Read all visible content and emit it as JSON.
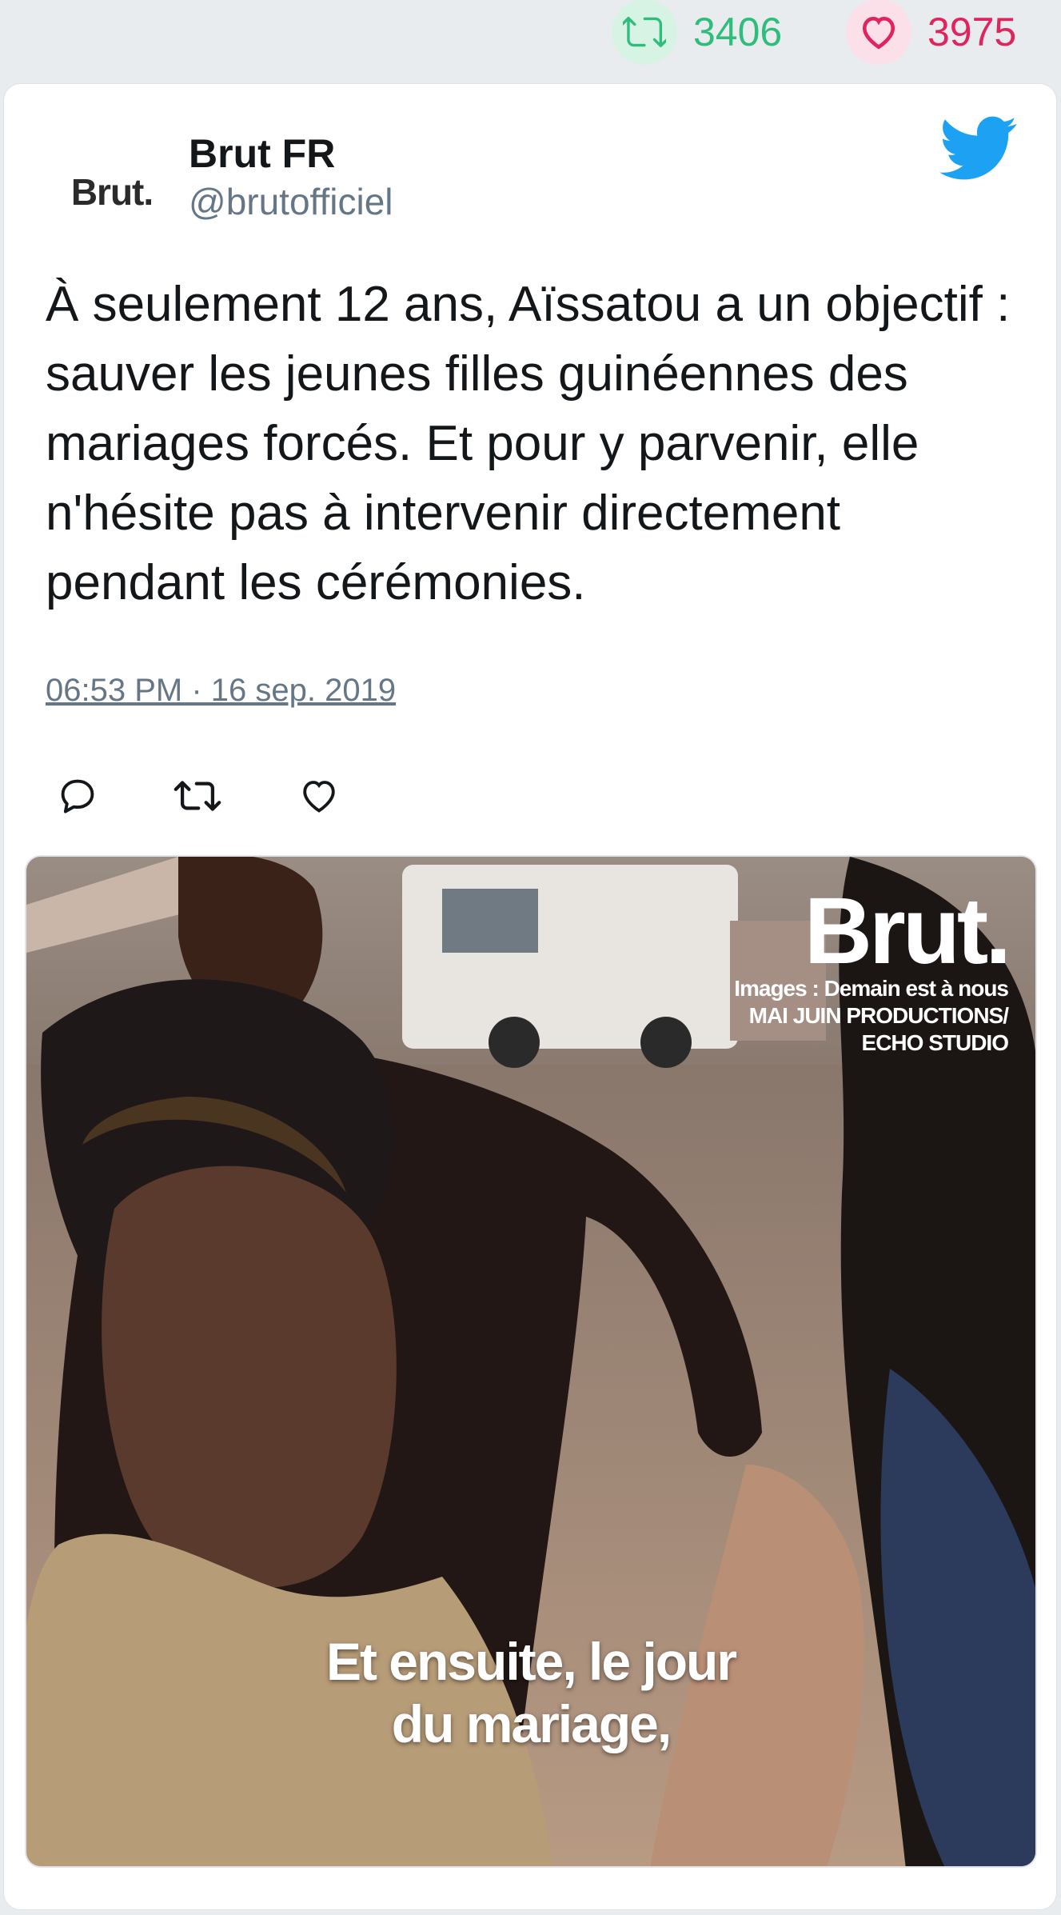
{
  "top_stats": {
    "retweets": "3406",
    "likes": "3975",
    "retweet_color": "#2fbd7c",
    "like_color": "#e0245e"
  },
  "tweet": {
    "avatar_text": "Brut.",
    "author_name": "Brut FR",
    "author_handle": "@brutofficiel",
    "text": "À seulement 12 ans, Aïssatou a un objectif : sauver les jeunes filles guinéennes des mariages forcés. Et pour y parvenir, elle n'hésite pas à intervenir directement pendant les cérémonies.",
    "timestamp": "06:53 PM · 16 sep. 2019",
    "icons": {
      "brand": "twitter-bird-icon",
      "reply": "reply-icon",
      "retweet": "retweet-icon",
      "like": "heart-icon"
    },
    "brand_color": "#1da1f2"
  },
  "media": {
    "watermark_logo": "Brut.",
    "credit_line_1": "Images : Demain est à nous",
    "credit_line_2": "MAI JUIN PRODUCTIONS/",
    "credit_line_3": "ECHO STUDIO",
    "subtitle_line_1": "Et ensuite, le jour",
    "subtitle_line_2": "du mariage,"
  }
}
